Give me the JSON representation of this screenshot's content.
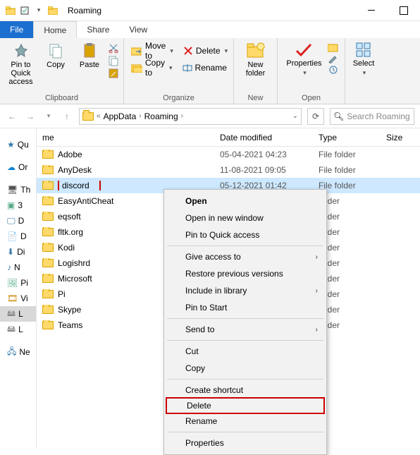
{
  "titlebar": {
    "title": "Roaming"
  },
  "tabs": {
    "file": "File",
    "home": "Home",
    "share": "Share",
    "view": "View"
  },
  "ribbon": {
    "clipboard": {
      "label": "Clipboard",
      "pin": "Pin to Quick access",
      "copy": "Copy",
      "paste": "Paste"
    },
    "organize": {
      "label": "Organize",
      "moveto": "Move to",
      "copyto": "Copy to",
      "delete": "Delete",
      "rename": "Rename"
    },
    "new": {
      "label": "New",
      "newfolder": "New folder"
    },
    "open": {
      "label": "Open",
      "properties": "Properties"
    },
    "select": {
      "label": "",
      "select": "Select"
    }
  },
  "breadcrumb": {
    "segments": [
      "AppData",
      "Roaming"
    ]
  },
  "search": {
    "placeholder": "Search Roaming"
  },
  "columns": {
    "name": "me",
    "date": "Date modified",
    "type": "Type",
    "size": "Size"
  },
  "rows": [
    {
      "name": "Adobe",
      "date": "05-04-2021 04:23",
      "type": "File folder"
    },
    {
      "name": "AnyDesk",
      "date": "11-08-2021 09:05",
      "type": "File folder"
    },
    {
      "name": "discord",
      "date": "05-12-2021 01:42",
      "type": "File folder",
      "selected": true,
      "highlight": true
    },
    {
      "name": "EasyAntiCheat",
      "date": "",
      "type": "folder"
    },
    {
      "name": "eqsoft",
      "date": "",
      "type": "folder"
    },
    {
      "name": "fltk.org",
      "date": "",
      "type": "folder"
    },
    {
      "name": "Kodi",
      "date": "",
      "type": "folder"
    },
    {
      "name": "Logishrd",
      "date": "",
      "type": "folder"
    },
    {
      "name": "Microsoft",
      "date": "",
      "type": "folder"
    },
    {
      "name": "Pi",
      "date": "",
      "type": "folder"
    },
    {
      "name": "Skype",
      "date": "",
      "type": "folder"
    },
    {
      "name": "Teams",
      "date": "",
      "type": "folder"
    }
  ],
  "sidebar": {
    "items": [
      {
        "label": "Qu",
        "star": true
      },
      {
        "label": "Or",
        "cloud": true
      },
      {
        "label": "Th"
      },
      {
        "label": "3"
      },
      {
        "label": "D"
      },
      {
        "label": "D"
      },
      {
        "label": "Di",
        "down": true
      },
      {
        "label": "N"
      },
      {
        "label": "Pi"
      },
      {
        "label": "Vi"
      },
      {
        "label": "L",
        "selected": true
      },
      {
        "label": "L"
      },
      {
        "label": ""
      },
      {
        "label": "Ne"
      }
    ]
  },
  "context_menu": {
    "open": "Open",
    "open_new": "Open in new window",
    "pin_quick": "Pin to Quick access",
    "give_access": "Give access to",
    "restore": "Restore previous versions",
    "include_lib": "Include in library",
    "pin_start": "Pin to Start",
    "send_to": "Send to",
    "cut": "Cut",
    "copy": "Copy",
    "create_shortcut": "Create shortcut",
    "delete": "Delete",
    "rename": "Rename",
    "properties": "Properties"
  }
}
